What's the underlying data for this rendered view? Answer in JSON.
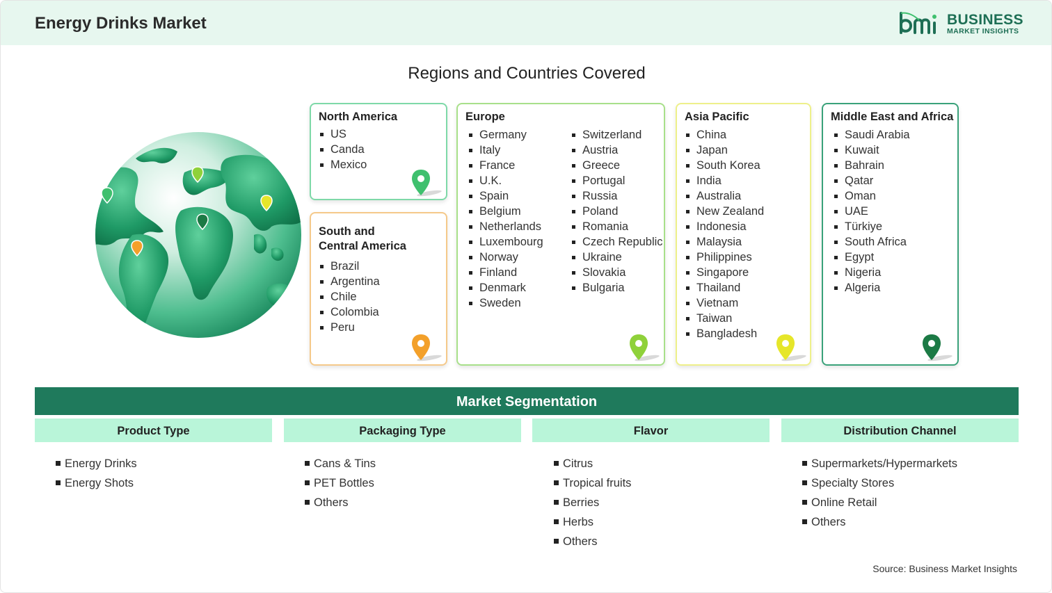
{
  "header": {
    "title": "Energy Drinks Market",
    "logo_line1": "BUSINESS",
    "logo_line2": "MARKET INSIGHTS",
    "brand_color": "#1e6f55"
  },
  "regions_title": "Regions and Countries Covered",
  "regions": {
    "north_america": {
      "title": "North America",
      "items": [
        "US",
        "Canda",
        "Mexico"
      ],
      "color": "#7ed9a8"
    },
    "south_america": {
      "title_line1": "South and",
      "title_line2": "Central America",
      "items": [
        "Brazil",
        "Argentina",
        "Chile",
        "Colombia",
        "Peru"
      ],
      "color": "#f5c98a"
    },
    "europe": {
      "title": "Europe",
      "col1": [
        "Germany",
        "Italy",
        "France",
        "U.K.",
        "Spain",
        "Belgium",
        "Netherlands",
        "Luxembourg",
        "Norway",
        "Finland",
        "Denmark",
        "Sweden"
      ],
      "col2": [
        "Switzerland",
        "Austria",
        "Greece",
        "Portugal",
        "Russia",
        "Poland",
        "Romania",
        "Czech Republic",
        "Ukraine",
        "Slovakia",
        "Bulgaria"
      ],
      "color": "#a8e08a"
    },
    "asia_pacific": {
      "title": "Asia Pacific",
      "items": [
        "China",
        "Japan",
        "South Korea",
        "India",
        "Australia",
        "New Zealand",
        "Indonesia",
        "Malaysia",
        "Philippines",
        "Singapore",
        "Thailand",
        "Vietnam",
        "Taiwan",
        "Bangladesh"
      ],
      "color": "#eef08a"
    },
    "mea": {
      "title": "Middle East and Africa",
      "items": [
        "Saudi Arabia",
        "Kuwait",
        "Bahrain",
        "Qatar",
        "Oman",
        "UAE",
        "Türkiye",
        "South Africa",
        "Egypt",
        "Nigeria",
        "Algeria"
      ],
      "color": "#3aa27a"
    }
  },
  "icons": {
    "globe": "globe-icon",
    "pin": "map-pin-icon"
  },
  "pin_colors": {
    "north_america": "#3fc06e",
    "south_america": "#f3a02a",
    "europe": "#8fd13a",
    "asia_pacific": "#e6e62a",
    "mea": "#1c7a45"
  },
  "segmentation": {
    "title": "Market Segmentation",
    "columns": [
      {
        "header": "Product Type",
        "items": [
          "Energy Drinks",
          "Energy Shots"
        ]
      },
      {
        "header": "Packaging Type",
        "items": [
          "Cans & Tins",
          "PET Bottles",
          "Others"
        ]
      },
      {
        "header": "Flavor",
        "items": [
          "Citrus",
          "Tropical fruits",
          "Berries",
          "Herbs",
          "Others"
        ]
      },
      {
        "header": "Distribution Channel",
        "items": [
          "Supermarkets/Hypermarkets",
          "Specialty Stores",
          "Online Retail",
          "Others"
        ]
      }
    ]
  },
  "source": "Source: Business Market Insights"
}
